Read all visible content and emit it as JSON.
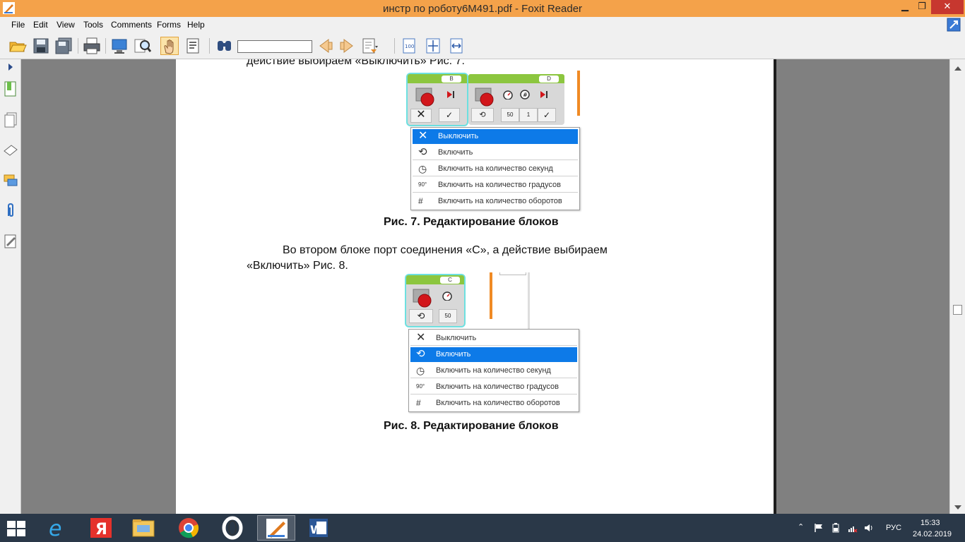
{
  "window": {
    "title": "инстр по роботу6М491.pdf - Foxit Reader",
    "min_glyph": "▁",
    "max_glyph": "❐",
    "close_glyph": "✕"
  },
  "menu": {
    "items": [
      "File",
      "Edit",
      "View",
      "Tools",
      "Comments",
      "Forms",
      "Help"
    ]
  },
  "toolbar": {
    "search_value": "",
    "icons": [
      "open-folder-icon",
      "save-icon",
      "save-as-icon",
      "print-icon",
      "screen-icon",
      "zoom-glass-icon",
      "hand-tool-icon",
      "select-text-icon",
      "find-binoculars-icon",
      "prev-arrow-icon",
      "next-arrow-icon",
      "export-icon",
      "actual-size-icon",
      "fit-page-icon",
      "fit-width-icon"
    ],
    "active_tool": "hand-tool-icon"
  },
  "sidebar": {
    "icons": [
      "bookmarks-icon",
      "pages-icon",
      "layers-icon",
      "comments-icon",
      "attachments-icon",
      "signature-icon"
    ]
  },
  "document": {
    "top_line": "действие выбираем «Выключить» Рис. 7.",
    "caption7": "Рис. 7. Редактирование блоков",
    "para_line1": "Во втором блоке порт соединения «С», а действие выбираем",
    "para_line2": "«Включить» Рис. 8.",
    "caption8": "Рис. 8. Редактирование блоков",
    "fig7": {
      "port_b": "B",
      "port_d": "D",
      "val_50": "50",
      "val_1": "1",
      "menu": [
        {
          "label": "Выключить",
          "icon": "x-icon",
          "selected": true
        },
        {
          "label": "Включить",
          "icon": "rotate-icon",
          "selected": false
        },
        {
          "label": "Включить на количество секунд",
          "icon": "timer-icon",
          "selected": false
        },
        {
          "label": "Включить на количество градусов",
          "icon": "degrees-icon",
          "selected": false
        },
        {
          "label": "Включить на количество оборотов",
          "icon": "rotations-icon",
          "selected": false
        }
      ]
    },
    "fig8": {
      "port_c": "C",
      "val_50": "50",
      "menu": [
        {
          "label": "Выключить",
          "icon": "x-icon",
          "selected": false
        },
        {
          "label": "Включить",
          "icon": "rotate-icon",
          "selected": true
        },
        {
          "label": "Включить на количество секунд",
          "icon": "timer-icon",
          "selected": false
        },
        {
          "label": "Включить на количество градусов",
          "icon": "degrees-icon",
          "selected": false
        },
        {
          "label": "Включить на количество оборотов",
          "icon": "rotations-icon",
          "selected": false
        }
      ]
    }
  },
  "taskbar": {
    "apps": [
      "windows-start-icon",
      "internet-explorer-icon",
      "yandex-browser-icon",
      "file-explorer-icon",
      "chrome-icon",
      "opera-icon",
      "foxit-reader-icon",
      "word-icon"
    ],
    "active_app": "foxit-reader-icon",
    "lang": "РУС",
    "time": "15:33",
    "date": "24.02.2019"
  },
  "colors": {
    "titlebar": "#f4a24a",
    "close": "#c7372f",
    "menu_selected": "#0d7ae8",
    "block_top": "#8cc63f",
    "motor_red": "#d2161b",
    "taskbar": "#2a3848"
  }
}
